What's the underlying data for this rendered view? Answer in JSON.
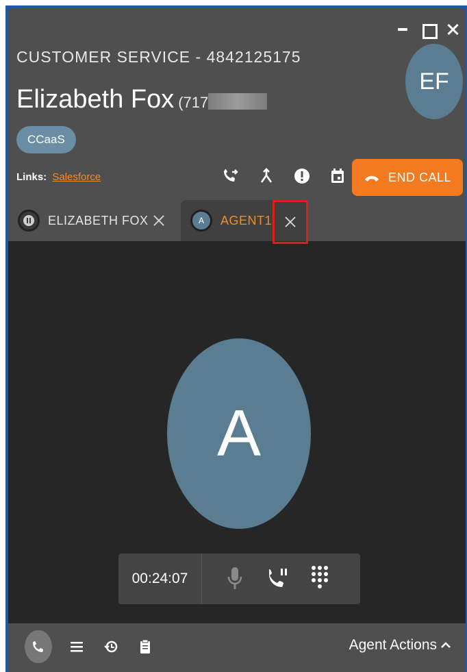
{
  "window": {
    "minimize_icon": "minimize-icon",
    "maximize_icon": "maximize-icon",
    "close_icon": "close-icon"
  },
  "header": {
    "queue_line": "CUSTOMER SERVICE - 4842125175",
    "caller_name": "Elizabeth Fox",
    "caller_phone_prefix": "(717",
    "avatar_initials": "EF",
    "tag": "CCaaS",
    "links_label": "Links:",
    "links_value": "Salesforce"
  },
  "toolbar": {
    "icons": [
      "transfer-call-icon",
      "merge-icon",
      "alert-icon",
      "calendar-icon"
    ],
    "end_call_label": "END CALL"
  },
  "tabs": [
    {
      "label": "ELIZABETH FOX",
      "avatar": "hold-icon"
    },
    {
      "label": "AGENT1",
      "avatar_initial": "A"
    }
  ],
  "agent": {
    "initial": "A"
  },
  "call_controls": {
    "timer": "00:24:07",
    "icons": [
      "microphone-icon",
      "hold-call-icon",
      "dialpad-icon"
    ]
  },
  "footer": {
    "icons": [
      "phone-icon",
      "list-icon",
      "history-icon",
      "clipboard-icon"
    ],
    "agent_actions_label": "Agent Actions"
  },
  "colors": {
    "accent": "#f47a20",
    "avatar": "#5a7d92",
    "highlight_box": "#e01e1e"
  }
}
